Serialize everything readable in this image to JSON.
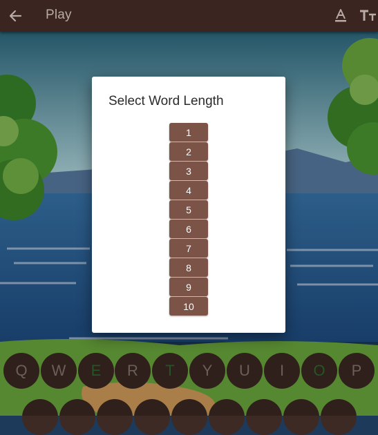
{
  "app_bar": {
    "title": "Play",
    "back_icon": "arrow-back-icon",
    "actions": [
      "font-color-icon",
      "text-size-icon"
    ]
  },
  "dialog": {
    "title": "Select Word Length",
    "options": [
      "1",
      "2",
      "3",
      "4",
      "5",
      "6",
      "7",
      "8",
      "9",
      "10"
    ]
  },
  "keyboard": {
    "row1": [
      {
        "letter": "Q",
        "state": "default"
      },
      {
        "letter": "W",
        "state": "default"
      },
      {
        "letter": "E",
        "state": "correct"
      },
      {
        "letter": "R",
        "state": "default"
      },
      {
        "letter": "T",
        "state": "correct"
      },
      {
        "letter": "Y",
        "state": "default"
      },
      {
        "letter": "U",
        "state": "default"
      },
      {
        "letter": "I",
        "state": "default"
      },
      {
        "letter": "O",
        "state": "correct"
      },
      {
        "letter": "P",
        "state": "default"
      }
    ]
  },
  "colors": {
    "app_bar": "#3a2520",
    "dialog_button": "#7b5347",
    "key_background": "#3d2a24",
    "key_correct_letter": "#2f6e2f"
  }
}
